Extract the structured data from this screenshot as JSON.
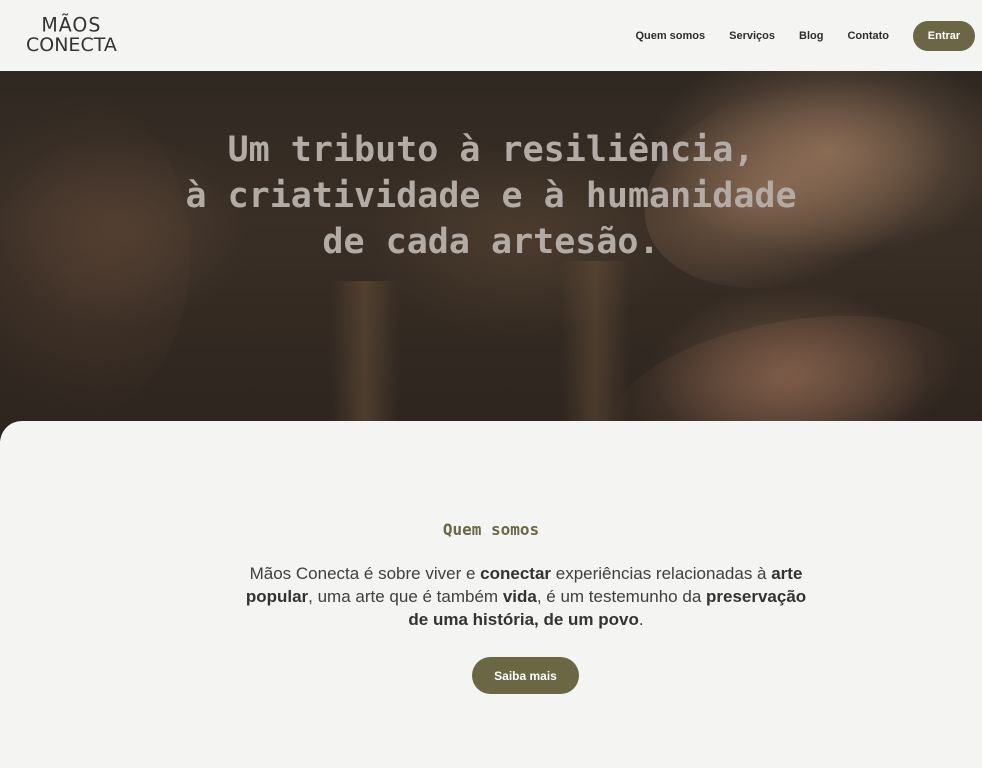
{
  "header": {
    "logo_top": "MÃOS",
    "logo_bottom": "CONECTA",
    "nav": [
      "Quem somos",
      "Serviços",
      "Blog",
      "Contato"
    ],
    "enter_label": "Entrar"
  },
  "hero": {
    "title_lines": [
      "Um tributo à resiliência,",
      "à criatividade e à humanidade",
      "de cada artesão."
    ]
  },
  "about": {
    "title": "Quem somos",
    "text": {
      "p1": "Mãos Conecta é sobre viver e ",
      "b1": "conectar",
      "p2": " experiências relacionadas à ",
      "b2": "arte popular",
      "p3": ", uma arte que é também ",
      "b3": "vida",
      "p4": ", é um testemunho da ",
      "b4": "preservação de uma história, de um povo",
      "p5": "."
    },
    "button_label": "Saiba mais"
  },
  "colors": {
    "accent": "#6b6744",
    "background": "#f4f4f3",
    "hero_text": "#b3aca6"
  }
}
